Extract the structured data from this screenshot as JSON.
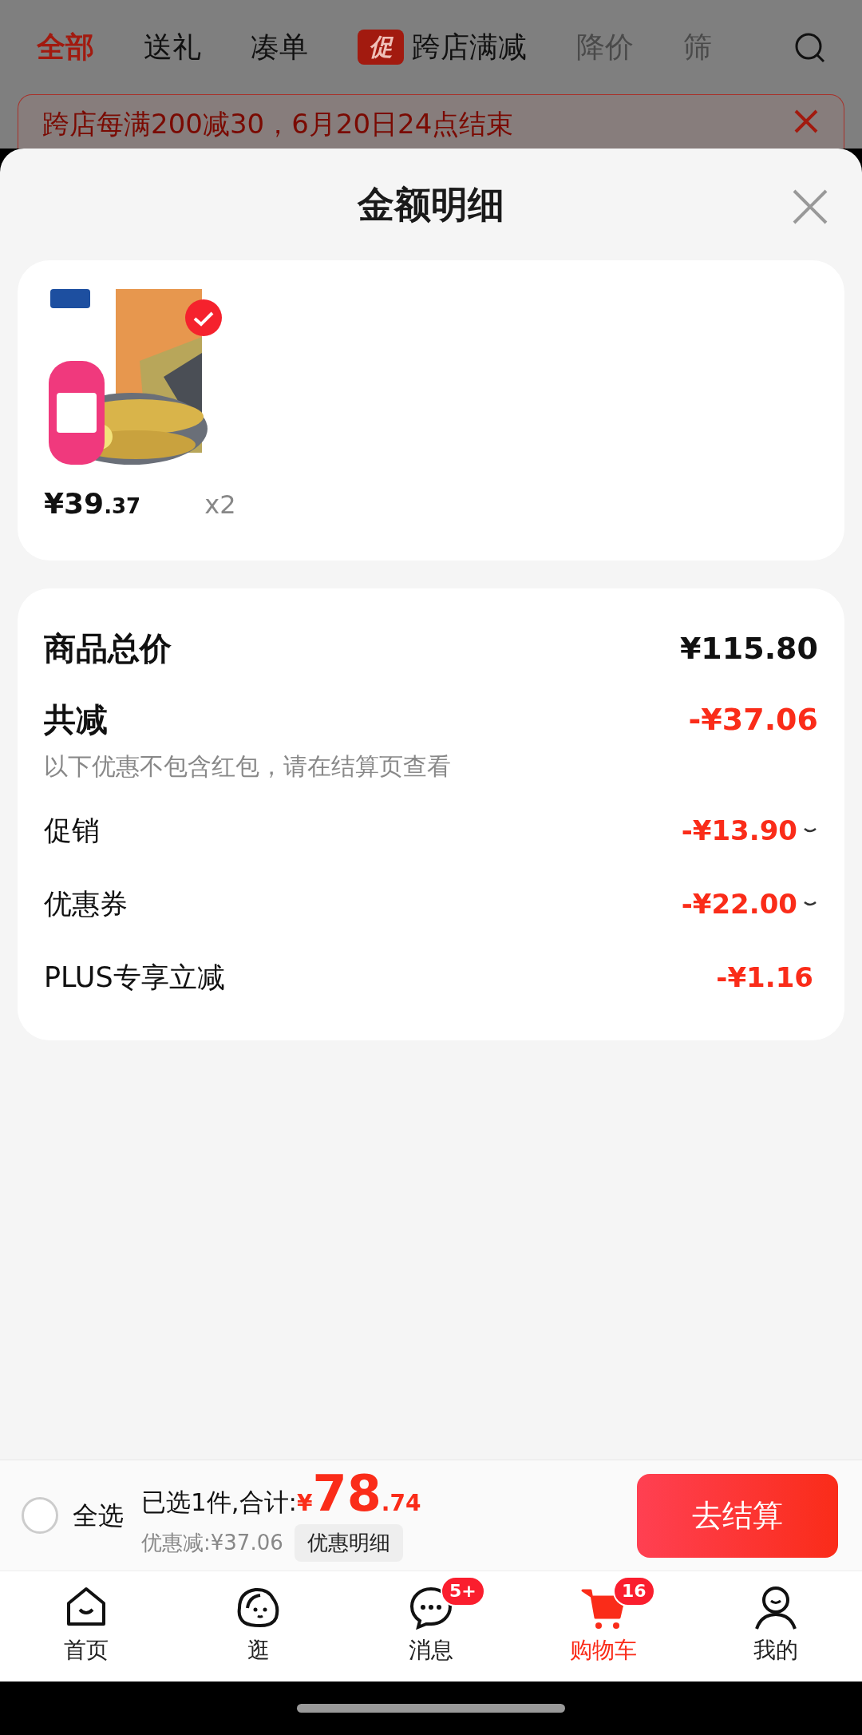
{
  "top_tabs": [
    {
      "label": "全部",
      "selected": true,
      "kind": "text"
    },
    {
      "label": "送礼",
      "selected": false,
      "kind": "text"
    },
    {
      "label": "凑单",
      "selected": false,
      "kind": "text"
    },
    {
      "label": "跨店满减",
      "selected": false,
      "kind": "promo",
      "tag": "促"
    },
    {
      "label": "降价",
      "selected": false,
      "kind": "faded"
    },
    {
      "label": "筛",
      "selected": false,
      "kind": "faded"
    }
  ],
  "banner": {
    "text": "跨店每满200减30，6月20日24点结束"
  },
  "sheet": {
    "title": "金额明细"
  },
  "product": {
    "kind": "picture",
    "selected": true,
    "price_main": "¥39",
    "price_decimal": ".37",
    "quantity": "x2"
  },
  "summary": {
    "total_label": "商品总价",
    "total_value": "¥115.80",
    "discount_label": "共减",
    "discount_value": "-¥37.06",
    "note": "以下优惠不包含红包，请在结算页查看",
    "rows": [
      {
        "label": "促销",
        "value": "-¥13.90",
        "expandable": true
      },
      {
        "label": "优惠券",
        "value": "-¥22.00",
        "expandable": true
      },
      {
        "label": "PLUS专享立减",
        "value": "-¥1.16",
        "expandable": false
      }
    ]
  },
  "checkout_bar": {
    "select_all": {
      "label": "全选",
      "checked": false
    },
    "selected_text": "已选1件,合计:",
    "currency": "¥",
    "amount_main": "78",
    "amount_decimal": ".74",
    "discount_text": "优惠减:¥37.06",
    "details_button": "优惠明细",
    "checkout_button": "去结算"
  },
  "bottom_nav": [
    {
      "label": "首页",
      "selected": false
    },
    {
      "label": "逛",
      "selected": false
    },
    {
      "label": "消息",
      "badge": "5+",
      "selected": false
    },
    {
      "label": "购物车",
      "badge": "16",
      "selected": true
    },
    {
      "label": "我的",
      "selected": false
    }
  ]
}
